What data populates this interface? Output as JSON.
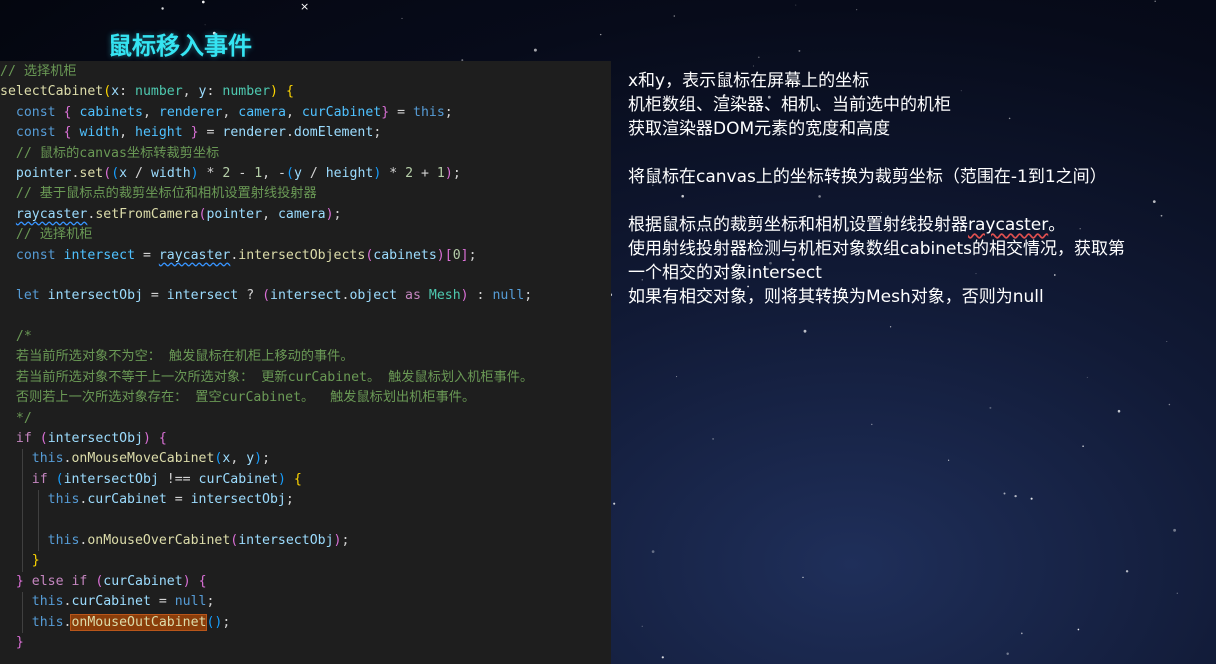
{
  "slide": {
    "title": "鼠标移入事件"
  },
  "code": {
    "lines": [
      "// 选择机柜",
      "selectCabinet(x: number, y: number) {",
      "  const { cabinets, renderer, camera, curCabinet} = this;",
      "  const { width, height } = renderer.domElement;",
      "  // 鼠标的canvas坐标转裁剪坐标",
      "  pointer.set((x / width) * 2 - 1, -(y / height) * 2 + 1);",
      "  // 基于鼠标点的裁剪坐标位和相机设置射线投射器",
      "  raycaster.setFromCamera(pointer, camera);",
      "  // 选择机柜",
      "  const intersect = raycaster.intersectObjects(cabinets)[0];",
      "",
      "  let intersectObj = intersect ? (intersect.object as Mesh) : null;",
      "",
      "  /*",
      "  若当前所选对象不为空： 触发鼠标在机柜上移动的事件。",
      "  若当前所选对象不等于上一次所选对象： 更新curCabinet。 触发鼠标划入机柜事件。",
      "  否则若上一次所选对象存在： 置空curCabinet。  触发鼠标划出机柜事件。",
      "  */",
      "  if (intersectObj) {",
      "    this.onMouseMoveCabinet(x, y);",
      "    if (intersectObj !== curCabinet) {",
      "      this.curCabinet = intersectObj;",
      "",
      "      this.onMouseOverCabinet(intersectObj);",
      "    }",
      "  } else if (curCabinet) {",
      "    this.curCabinet = null;",
      "    this.onMouseOutCabinet();",
      "  }"
    ]
  },
  "notes": {
    "line1": "x和y，表示鼠标在屏幕上的坐标",
    "line2": "机柜数组、渲染器、相机、当前选中的机柜",
    "line3": "获取渲染器DOM元素的宽度和高度",
    "line4": "将鼠标在canvas上的坐标转换为裁剪坐标（范围在-1到1之间）",
    "line5_prefix": "根据鼠标点的裁剪坐标和相机设置射线投射器",
    "line5_word": "raycaster",
    "line5_suffix": "。",
    "line6": "使用射线投射器检测与机柜对象数组cabinets的相交情况，获取第",
    "line7": "一个相交的对象intersect",
    "line8": "如果有相交对象，则将其转换为Mesh对象，否则为null"
  },
  "cursor": {
    "glyph": "×"
  },
  "colors": {
    "title": "#35e4f2",
    "editor_background": "#1e1e1e",
    "comment": "#6a9955",
    "keyword": "#569cd6",
    "function": "#dcdcaa",
    "variable": "#9cdcfe",
    "highlight": "#8a3d0a"
  }
}
